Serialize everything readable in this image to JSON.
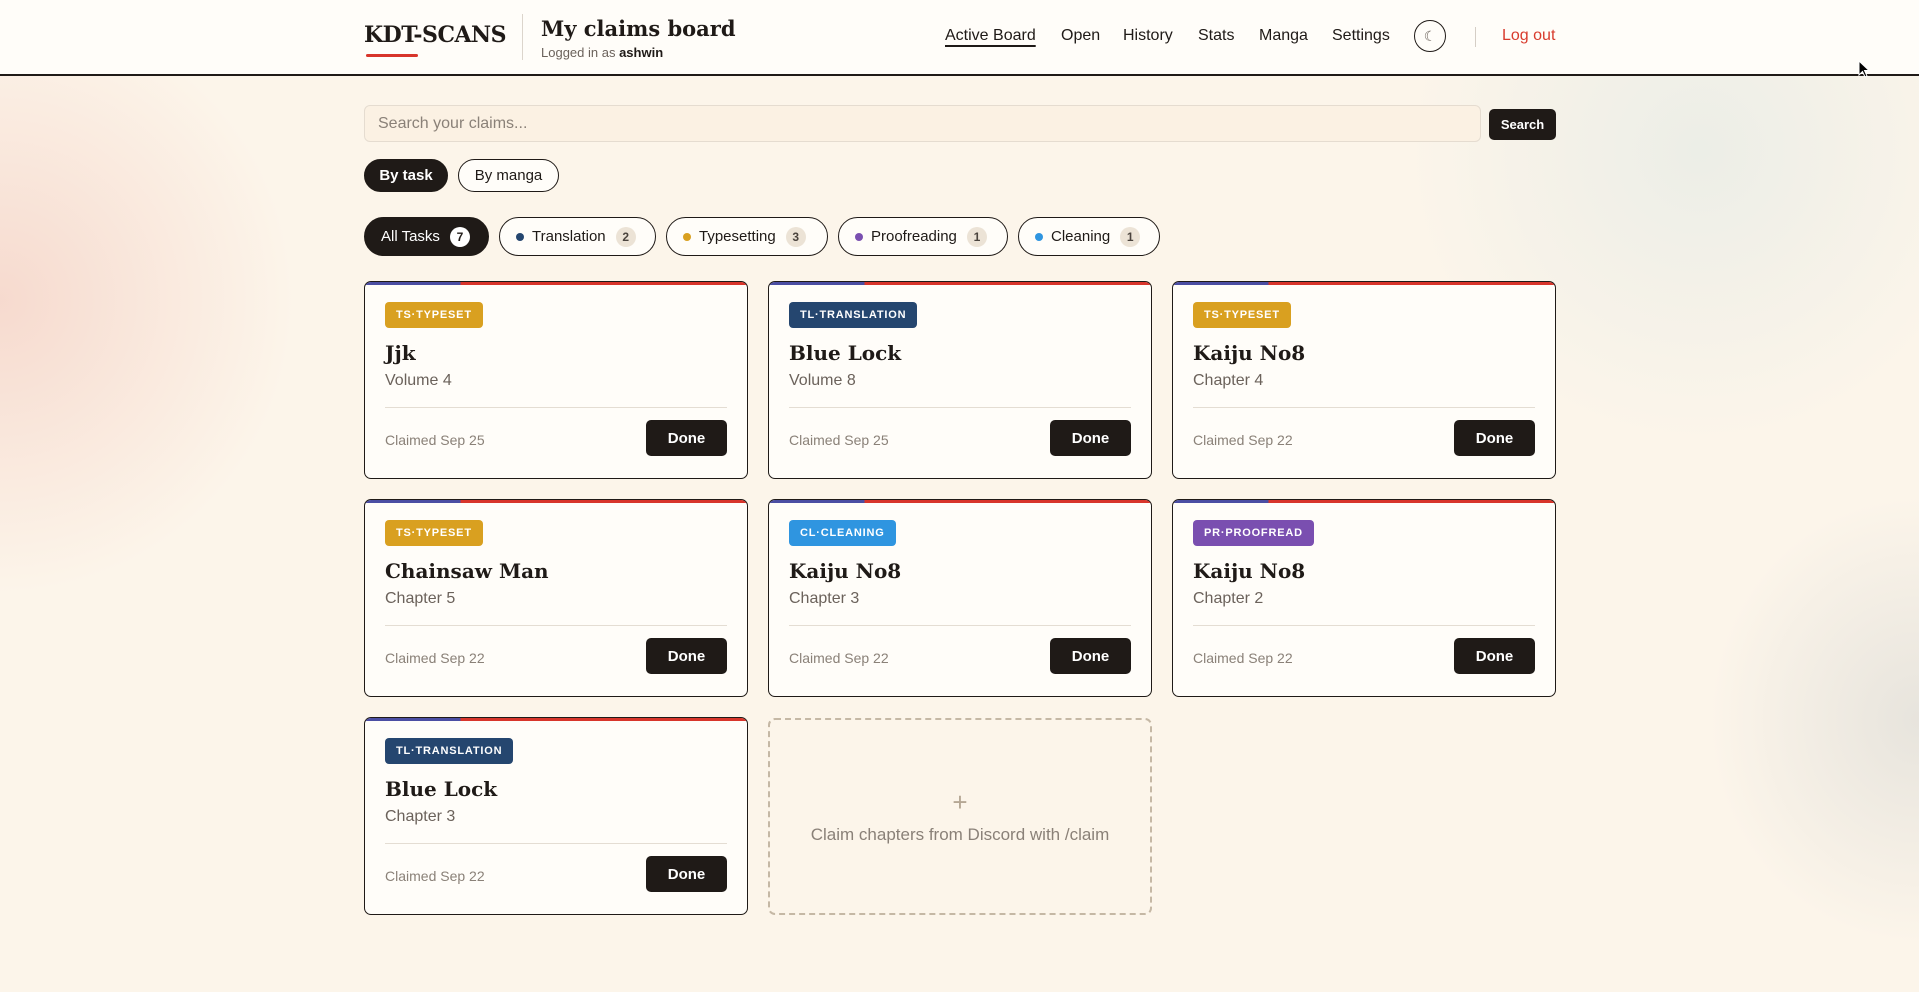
{
  "header": {
    "logo": "KDT-SCANS",
    "title": "My claims board",
    "logged_in_prefix": "Logged in as",
    "username": "ashwin",
    "nav": [
      "Active Board",
      "Open",
      "History",
      "Stats",
      "Manga",
      "Settings"
    ],
    "theme_icon": "☾",
    "logout": "Log out"
  },
  "search": {
    "placeholder": "Search your claims...",
    "value": "",
    "button": "Search"
  },
  "view_toggle": [
    "By task",
    "By manga"
  ],
  "filters": [
    {
      "label": "All Tasks",
      "count": "7"
    },
    {
      "label": "Translation",
      "count": "2",
      "color": "#25466f"
    },
    {
      "label": "Typesetting",
      "count": "3",
      "color": "#d9a020"
    },
    {
      "label": "Proofreading",
      "count": "1",
      "color": "#7a4fb0"
    },
    {
      "label": "Cleaning",
      "count": "1",
      "color": "#2f95e0"
    }
  ],
  "colors": {
    "translation": "#25466f",
    "typeset": "#d9a020",
    "proofread": "#7a4fb0",
    "cleaning": "#2f95e0",
    "accent": "#d8352b"
  },
  "cards": [
    {
      "badge": "TS·TYPESET",
      "title": "Jjk",
      "subtitle": "Volume 4",
      "claimed": "Claimed Sep 25",
      "action": "Done"
    },
    {
      "badge": "TL·TRANSLATION",
      "title": "Blue Lock",
      "subtitle": "Volume 8",
      "claimed": "Claimed Sep 25",
      "action": "Done"
    },
    {
      "badge": "TS·TYPESET",
      "title": "Kaiju No8",
      "subtitle": "Chapter 4",
      "claimed": "Claimed Sep 22",
      "action": "Done"
    },
    {
      "badge": "TS·TYPESET",
      "title": "Chainsaw Man",
      "subtitle": "Chapter 5",
      "claimed": "Claimed Sep 22",
      "action": "Done"
    },
    {
      "badge": "CL·CLEANING",
      "title": "Kaiju No8",
      "subtitle": "Chapter 3",
      "claimed": "Claimed Sep 22",
      "action": "Done"
    },
    {
      "badge": "PR·PROOFREAD",
      "title": "Kaiju No8",
      "subtitle": "Chapter 2",
      "claimed": "Claimed Sep 22",
      "action": "Done"
    },
    {
      "badge": "TL·TRANSLATION",
      "title": "Blue Lock",
      "subtitle": "Chapter 3",
      "claimed": "Claimed Sep 22",
      "action": "Done"
    }
  ],
  "empty_slot": {
    "icon": "+",
    "message": "Claim chapters from Discord with /claim"
  }
}
